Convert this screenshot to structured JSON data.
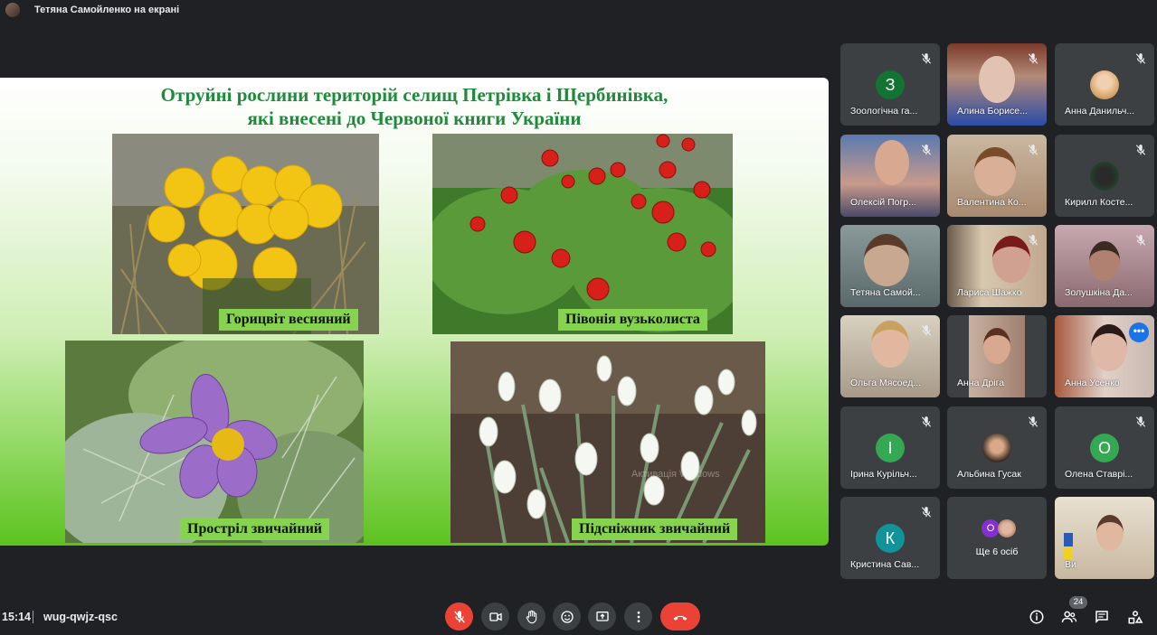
{
  "topbar": {
    "title": "Тетяна Самойленко на екрані"
  },
  "slide": {
    "title_line1": "Отруйні рослини територій селищ Петрівка і Щербинівка,",
    "title_line2": "які внесені до Червоної книги України",
    "captions": [
      "Горицвіт весняний",
      "Півонія вузьколиста",
      "Прострiл звичайний",
      "Підсніжник звичайний"
    ],
    "watermark": "Активація Windows"
  },
  "participants": [
    {
      "name": "Зоологічна га...",
      "initial": "З",
      "color": "#137333"
    },
    {
      "name": "Алина Борисе...",
      "initial": "",
      "color": ""
    },
    {
      "name": "Анна Данильч...",
      "initial": "",
      "color": ""
    },
    {
      "name": "Олексій Погр...",
      "initial": "",
      "color": ""
    },
    {
      "name": "Валентина Ко...",
      "initial": "",
      "color": ""
    },
    {
      "name": "Кирилл Косте...",
      "initial": "",
      "color": ""
    },
    {
      "name": "Тетяна Самой...",
      "initial": "",
      "color": ""
    },
    {
      "name": "Лариса Шажко",
      "initial": "",
      "color": ""
    },
    {
      "name": "Золушкіна Да...",
      "initial": "",
      "color": ""
    },
    {
      "name": "Ольга Мясоед...",
      "initial": "",
      "color": ""
    },
    {
      "name": "Анна Дріга",
      "initial": "",
      "color": ""
    },
    {
      "name": "Анна Усенко",
      "initial": "",
      "color": ""
    },
    {
      "name": "Ірина Курільч...",
      "initial": "І",
      "color": "#34a853"
    },
    {
      "name": "Альбина Гусак",
      "initial": "",
      "color": ""
    },
    {
      "name": "Олена Ставрі...",
      "initial": "О",
      "color": "#34a853"
    },
    {
      "name": "Кристина Сав...",
      "initial": "К",
      "color": "#12939a"
    },
    {
      "name": "Ще 6 осіб",
      "initial": "О",
      "color": "#8430ce"
    },
    {
      "name": "Ви",
      "initial": "",
      "color": ""
    }
  ],
  "bottom": {
    "time": "15:14",
    "code": "wug-qwjz-qsc",
    "people_count": "24"
  },
  "icons": {
    "mic": "mic-off-icon",
    "camera": "camera-icon",
    "hand": "raise-hand-icon",
    "emoji": "emoji-icon",
    "present": "present-icon",
    "more": "more-vert-icon",
    "hangup": "hangup-icon",
    "info": "info-icon",
    "people": "people-icon",
    "chat": "chat-icon",
    "activities": "activities-icon"
  },
  "colors": {
    "accent": "#8ab4f8",
    "danger": "#ea4335",
    "slide_title": "#1e8a3c"
  }
}
